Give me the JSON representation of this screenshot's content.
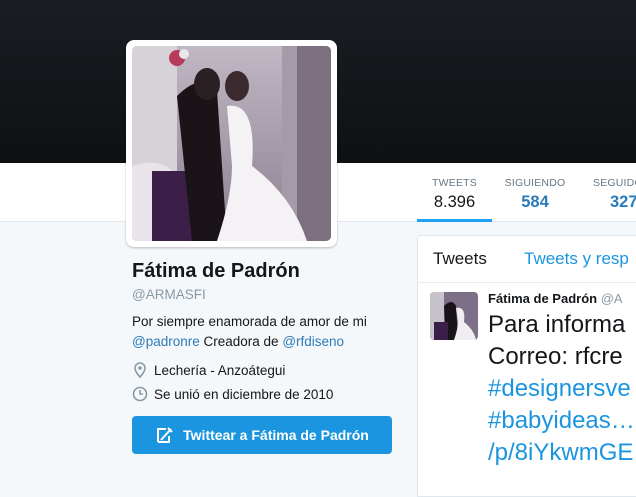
{
  "profile": {
    "name": "Fátima de Padrón",
    "handle": "@ARMASFI",
    "bio_text": "Por siempre enamorada de amor de mi",
    "bio_mention1": "@padronre",
    "bio_middle": " Creadora de ",
    "bio_mention2": "@rfdiseno",
    "location": "Lechería - Anzoátegui",
    "joined": "Se unió en diciembre de 2010",
    "tweet_button": "Twittear a Fátima de Padrón"
  },
  "stats": [
    {
      "label": "TWEETS",
      "value": "8.396"
    },
    {
      "label": "SIGUIENDO",
      "value": "584"
    },
    {
      "label": "SEGUIDO",
      "value": "327"
    }
  ],
  "timeline": {
    "tabs": [
      "Tweets",
      "Tweets y resp"
    ],
    "tweet": {
      "author": "Fátima de Padrón",
      "handle": "@A",
      "line1": "Para informa",
      "line2": "Correo: rfcre",
      "line3": "#designersve",
      "line4": "#babyideas…",
      "line5": "/p/8iYkwmGE"
    }
  },
  "icons": {
    "location": "map-pin-icon",
    "joined": "calendar-icon",
    "tweet": "compose-icon"
  },
  "colors": {
    "accent": "#1b95e0",
    "link": "#2b7bb9",
    "header": "#14171a"
  }
}
